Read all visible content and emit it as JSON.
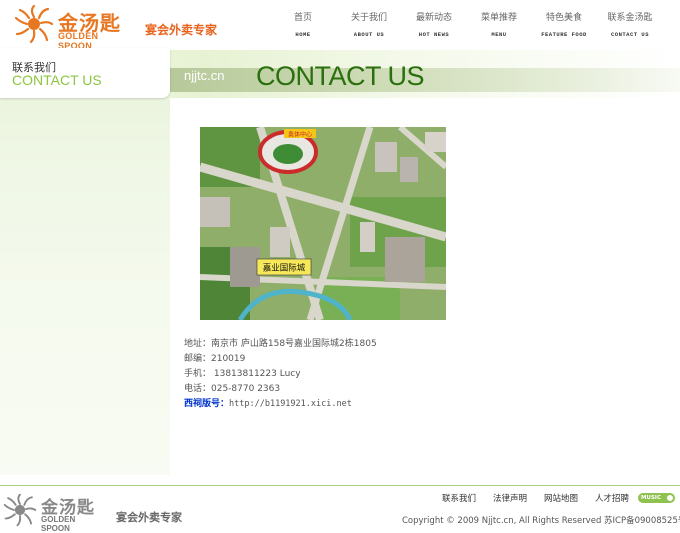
{
  "header": {
    "logo_cn": "金汤匙",
    "logo_en": "GOLDEN SPOON",
    "slogan": "宴会外卖专家"
  },
  "nav": [
    {
      "zh": "首页",
      "en": "HOME"
    },
    {
      "zh": "关于我们",
      "en": "ABOUT US"
    },
    {
      "zh": "最新动态",
      "en": "HOT NEWS"
    },
    {
      "zh": "菜单推荐",
      "en": "MENU"
    },
    {
      "zh": "特色美食",
      "en": "FEATURE FOOD"
    },
    {
      "zh": "联系金汤匙",
      "en": "CONTACT US"
    }
  ],
  "banner": {
    "site_tag": "njjtc.cn",
    "title": "CONTACT US"
  },
  "sidebar": {
    "title_zh": "联系我们",
    "title_en": "CONTACT US"
  },
  "map": {
    "landmark_label": "嘉业国际城",
    "stadium_label": "奥体中心"
  },
  "contact": {
    "address": "地址：南京市 庐山路158号嘉业国际城2栋1805",
    "postcode": "邮编：210019",
    "mobile": "手机： 13813811223  Lucy",
    "phone": "电话：025-8770 2363",
    "ad_label": "西祠版号：",
    "ad_link": "http://b1191921.xici.net"
  },
  "footer": {
    "logo_cn": "金汤匙",
    "logo_en": "GOLDEN SPOON",
    "slogan": "宴会外卖专家",
    "links": [
      "联系我们",
      "法律声明",
      "网站地图",
      "人才招聘"
    ],
    "music_label": "MUSIC",
    "copyright": "Copyright © 2009 Njjtc.cn, All Rights Reserved 苏ICP备09008525号"
  },
  "colors": {
    "brand_orange": "#e87722",
    "green_title": "#2a6f0d",
    "accent_green": "#8cc63f"
  }
}
